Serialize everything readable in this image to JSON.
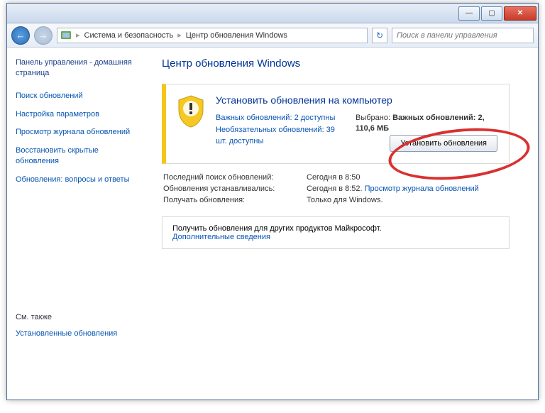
{
  "breadcrumb": {
    "level1": "Система и безопасность",
    "level2": "Центр обновления Windows"
  },
  "search": {
    "placeholder": "Поиск в панели управления"
  },
  "sidebar": {
    "home": "Панель управления - домашняя страница",
    "links": [
      "Поиск обновлений",
      "Настройка параметров",
      "Просмотр журнала обновлений",
      "Восстановить скрытые обновления",
      "Обновления: вопросы и ответы"
    ],
    "see_also_title": "См. также",
    "see_also_link": "Установленные обновления"
  },
  "main": {
    "title": "Центр обновления Windows",
    "alert": {
      "headline": "Установить обновления на компьютер",
      "important_link": "Важных обновлений: 2 доступны",
      "optional_link": "Необязательных обновлений: 39 шт. доступны",
      "selected_label": "Выбрано: ",
      "selected_bold": "Важных обновлений: 2, 110,6 МБ",
      "install_button": "Установить обновления"
    },
    "details": {
      "row1_label": "Последний поиск обновлений:",
      "row1_value": "Сегодня в 8:50",
      "row2_label": "Обновления устанавливались:",
      "row2_value": "Сегодня в 8:52. ",
      "row2_link": "Просмотр журнала обновлений",
      "row3_label": "Получать обновления:",
      "row3_value": "Только для Windows."
    },
    "promo": {
      "text": "Получить обновления для других продуктов Майкрософт.",
      "link": "Дополнительные сведения"
    }
  }
}
